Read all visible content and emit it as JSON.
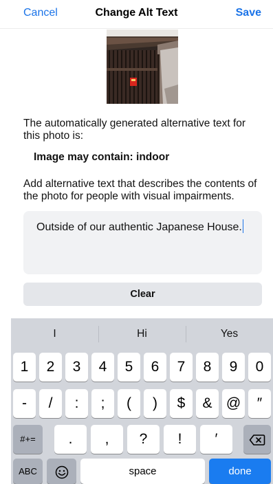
{
  "navbar": {
    "cancel_label": "Cancel",
    "title": "Change Alt Text",
    "save_label": "Save"
  },
  "photo": {
    "alt": "photo thumbnail of a Japanese house facade"
  },
  "content": {
    "auto_text_intro": "The automatically generated alternative text for this photo is:",
    "auto_text_value": "Image may contain: indoor",
    "instructions": "Add alternative text that describes the contents of the photo for people with visual impairments.",
    "alt_text_value": "Outside of our authentic Japanese House.",
    "clear_label": "Clear"
  },
  "keyboard": {
    "suggestions": [
      "I",
      "Hi",
      "Yes"
    ],
    "row1": [
      "1",
      "2",
      "3",
      "4",
      "5",
      "6",
      "7",
      "8",
      "9",
      "0"
    ],
    "row2": [
      "-",
      "/",
      ":",
      ";",
      "(",
      ")",
      "$",
      "&",
      "@",
      "″"
    ],
    "row3": {
      "mode_label": "#+=",
      "keys": [
        ".",
        ",",
        "?",
        "!",
        "′"
      ],
      "delete_icon": "delete-backspace-icon"
    },
    "row4": {
      "abc_label": "ABC",
      "emoji_icon": "emoji-icon",
      "space_label": "space",
      "done_label": "done"
    }
  },
  "colors": {
    "accent": "#1a73e8",
    "done_key": "#1a7cf0",
    "keyboard_bg": "#d2d5db",
    "function_key": "#abb0ba",
    "field_bg": "#f1f2f4"
  }
}
